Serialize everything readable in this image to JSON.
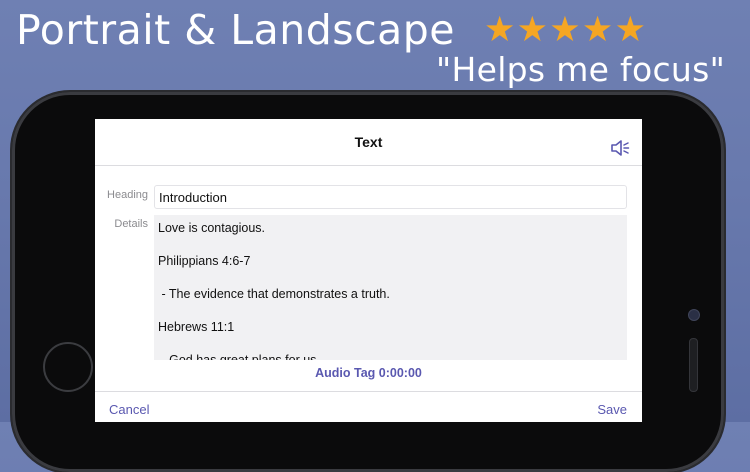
{
  "promo": {
    "headline": "Portrait & Landscape",
    "rating_stars": [
      "★",
      "★",
      "★",
      "★",
      "★"
    ],
    "quote": "\"Helps me focus\"",
    "colors": {
      "star": "#f5a623",
      "text": "#ffffff",
      "accent": "#5a58b0"
    }
  },
  "screen": {
    "title": "Text",
    "speaker_icon": "speaker-muted-icon",
    "heading": {
      "label": "Heading",
      "value": "Introduction"
    },
    "details": {
      "label": "Details",
      "lines": [
        "Love is contagious.",
        "Philippians 4:6-7",
        " - The evidence that demonstrates a truth.",
        "Hebrews 11:1",
        " - God has great plans for us."
      ]
    },
    "audio_tag": "Audio Tag 0:00:00",
    "cancel": "Cancel",
    "save": "Save"
  }
}
